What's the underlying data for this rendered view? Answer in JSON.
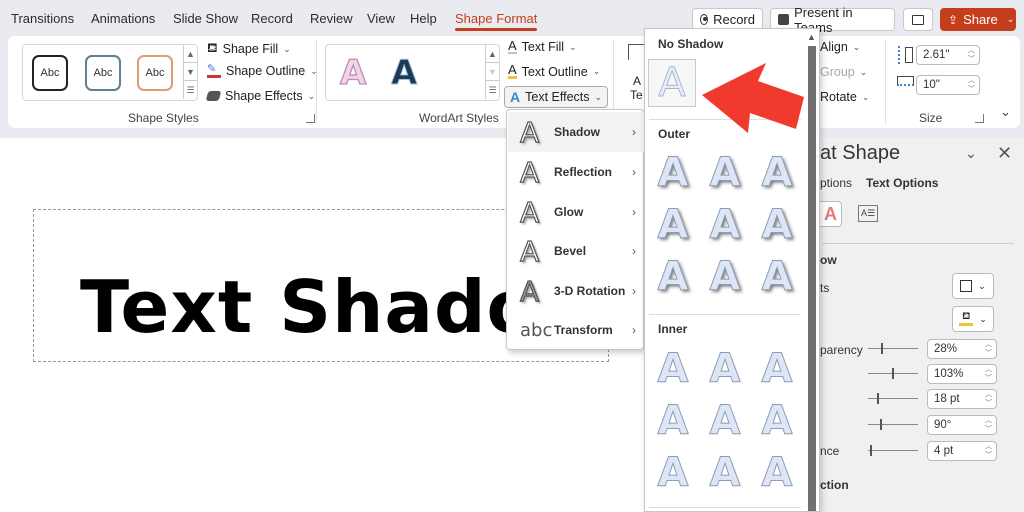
{
  "tabs": [
    "Transitions",
    "Animations",
    "Slide Show",
    "Record",
    "Review",
    "View",
    "Help",
    "Shape Format"
  ],
  "active_tab": "Shape Format",
  "titlebar_buttons": {
    "record": "Record",
    "present_in_teams": "Present in Teams",
    "share": "Share"
  },
  "ribbon": {
    "shape_styles": {
      "label": "Shape Styles",
      "presets": [
        "Abc",
        "Abc",
        "Abc"
      ],
      "shape_fill": "Shape Fill",
      "shape_outline": "Shape Outline",
      "shape_effects": "Shape Effects"
    },
    "wordart_styles": {
      "label": "WordArt Styles",
      "text_fill": "Text Fill",
      "text_outline": "Text Outline",
      "text_effects": "Text Effects"
    },
    "partial_alt_text": [
      "A",
      "Te"
    ],
    "arrange": {
      "align": "Align",
      "group": "Group",
      "rotate": "Rotate"
    },
    "size": {
      "label": "Size",
      "height": "2.61\"",
      "width": "10\""
    }
  },
  "slide": {
    "text": "Text Shadow"
  },
  "text_effects_menu": {
    "items": [
      {
        "label": "Shadow",
        "icon": "A"
      },
      {
        "label": "Reflection",
        "icon": "A"
      },
      {
        "label": "Glow",
        "icon": "A"
      },
      {
        "label": "Bevel",
        "icon": "A"
      },
      {
        "label": "3-D Rotation",
        "icon": "A"
      },
      {
        "label": "Transform",
        "icon": "abc"
      }
    ]
  },
  "shadow_gallery": {
    "no_shadow": "No Shadow",
    "outer": "Outer",
    "inner": "Inner",
    "glyph": "A"
  },
  "format_pane": {
    "title": "at Shape",
    "tab_shape_partial": "ptions",
    "tab_text": "Text Options",
    "section_shadow_partial": "ow",
    "presets_partial": "ts",
    "transparency_partial": "parency",
    "distance_partial": "nce",
    "section_reflection_partial": "ction",
    "values": {
      "transparency": "28%",
      "size": "103%",
      "blur": "18 pt",
      "angle": "90°",
      "distance": "4 pt"
    },
    "slider_levels": {
      "transparency": 0.28,
      "size": 0.5,
      "blur": 0.18,
      "angle": 0.25,
      "distance": 0.04
    }
  },
  "colors": {
    "accent": "#c43e1c",
    "red_arrow": "#f03a2e"
  }
}
